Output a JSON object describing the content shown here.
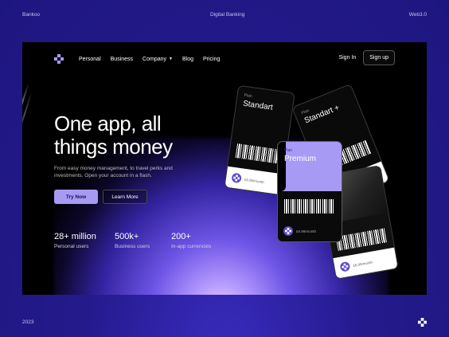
{
  "outer": {
    "brand": "Bankoo",
    "title": "Digital Banking",
    "tag": "Web3.0",
    "year": "2023"
  },
  "nav": {
    "links": [
      "Personal",
      "Business",
      "Company",
      "Blog",
      "Pricing"
    ],
    "signin": "Sign In",
    "signup": "Sign up"
  },
  "hero": {
    "title": "One app, all things money",
    "subtitle": "From easy money management, to travel perks and investments. Open your account in a flash.",
    "try_label": "Try Now",
    "learn_label": "Learn More"
  },
  "stats": [
    {
      "value": "28+ million",
      "label": "Personal users"
    },
    {
      "value": "500k+",
      "label": "Business users"
    },
    {
      "value": "200+",
      "label": "In-app currencies"
    }
  ],
  "cards": [
    {
      "plan_label": "Plan",
      "name": "Standart",
      "price": "£6.99/month"
    },
    {
      "plan_label": "Plan",
      "name": "Standart +",
      "price": ""
    },
    {
      "plan_label": "Plan",
      "name": "Premium",
      "price": "£6.99/month"
    },
    {
      "plan_label": "",
      "name": "",
      "price": "£6.99/month"
    }
  ],
  "colors": {
    "accent": "#a79af4",
    "background": "#241a8c",
    "frame": "#000000"
  }
}
